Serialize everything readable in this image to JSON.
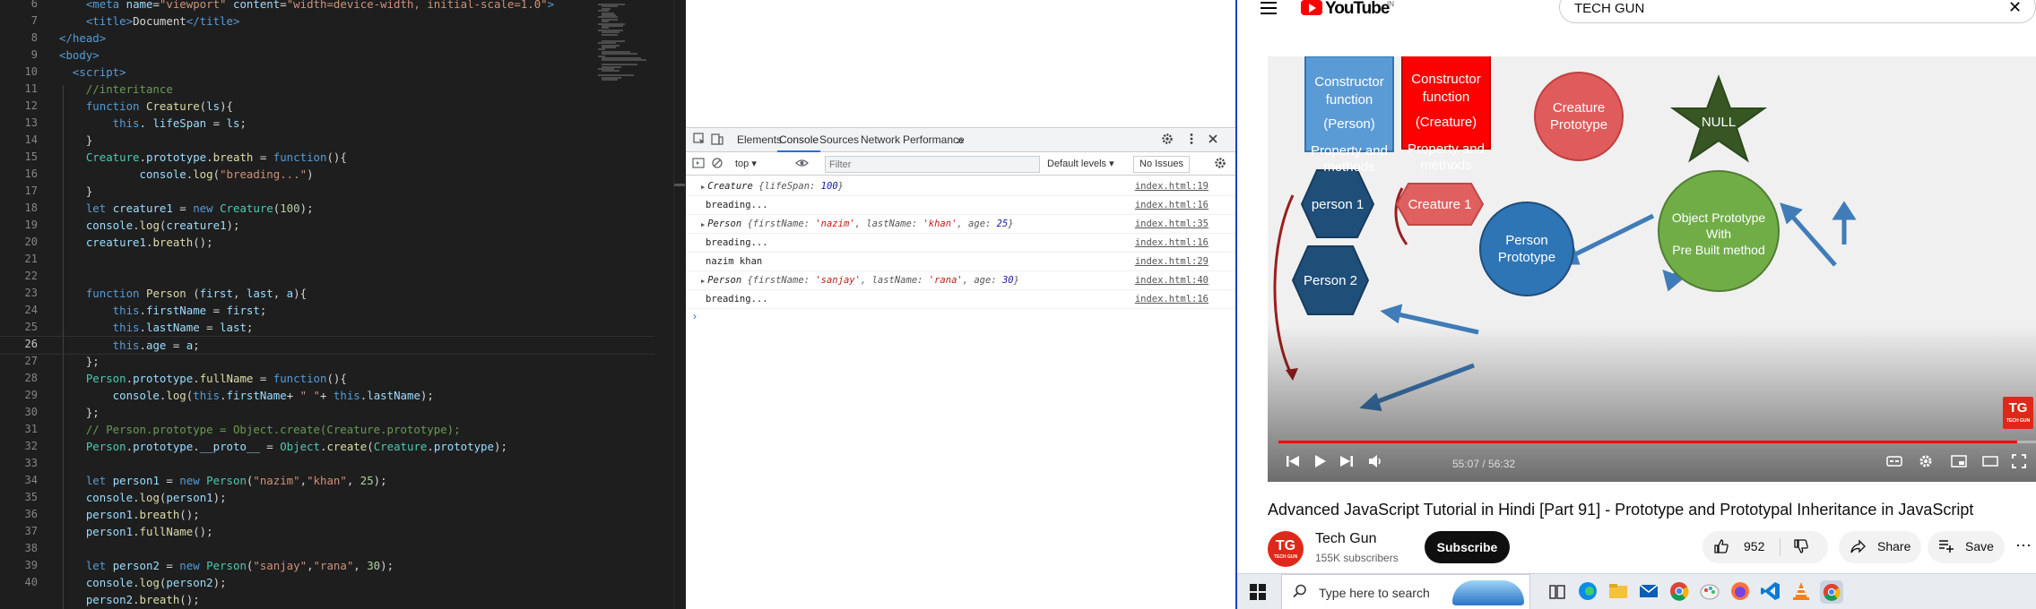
{
  "editor": {
    "line_numbers": [
      "6",
      "7",
      "8",
      "9",
      "10",
      "11",
      "12",
      "13",
      "14",
      "15",
      "16",
      "17",
      "18",
      "19",
      "20",
      "21",
      "22",
      "23",
      "24",
      "25",
      "26",
      "27",
      "28",
      "29",
      "30",
      "31",
      "32",
      "33",
      "34",
      "35",
      "36",
      "37",
      "38",
      "39",
      "40"
    ],
    "active_line": "26",
    "lines": [
      [
        [
          "tag",
          "    <meta "
        ],
        [
          "attr",
          "name"
        ],
        [
          "",
          "="
        ],
        [
          "str",
          "\"viewport\""
        ],
        [
          "",
          ""
        ],
        [
          "attr",
          " content"
        ],
        [
          "",
          "="
        ],
        [
          "str",
          "\"width=device-width, initial-scale=1.0\""
        ],
        [
          "tag",
          ">"
        ]
      ],
      [
        [
          "tag",
          "    <title>"
        ],
        [
          "",
          "Document"
        ],
        [
          "tag",
          "</title>"
        ]
      ],
      [
        [
          "tag",
          "</head>"
        ]
      ],
      [
        [
          "tag",
          "<body>"
        ]
      ],
      [
        [
          "tag",
          "  <script>"
        ]
      ],
      [
        [
          "cm",
          "    //interitance"
        ]
      ],
      [
        [
          "kw",
          "    function "
        ],
        [
          "fn",
          "Creature"
        ],
        [
          "",
          "("
        ],
        [
          "var",
          "ls"
        ],
        [
          "",
          "){"
        ]
      ],
      [
        [
          "kw",
          "        this"
        ],
        [
          "",
          ". "
        ],
        [
          "var",
          "lifeSpan"
        ],
        [
          "",
          " = "
        ],
        [
          "var",
          "ls"
        ],
        [
          "",
          ";"
        ]
      ],
      [
        [
          "",
          "    }"
        ]
      ],
      [
        [
          "cls",
          "    Creature"
        ],
        [
          "",
          "."
        ],
        [
          "var",
          "prototype"
        ],
        [
          "",
          "."
        ],
        [
          "fn",
          "breath"
        ],
        [
          "",
          " = "
        ],
        [
          "kw",
          "function"
        ],
        [
          "",
          "(){"
        ]
      ],
      [
        [
          "var",
          "            console"
        ],
        [
          "",
          "."
        ],
        [
          "fn",
          "log"
        ],
        [
          "",
          "("
        ],
        [
          "str",
          "\"breading...\""
        ],
        [
          "",
          ")"
        ]
      ],
      [
        [
          "",
          "    }"
        ]
      ],
      [
        [
          "kw",
          "    let "
        ],
        [
          "var",
          "creature1"
        ],
        [
          "",
          " = "
        ],
        [
          "kw",
          "new "
        ],
        [
          "cls",
          "Creature"
        ],
        [
          "",
          "("
        ],
        [
          "num",
          "100"
        ],
        [
          "",
          ");"
        ]
      ],
      [
        [
          "var",
          "    console"
        ],
        [
          "",
          "."
        ],
        [
          "fn",
          "log"
        ],
        [
          "",
          "("
        ],
        [
          "var",
          "creature1"
        ],
        [
          "",
          ");"
        ]
      ],
      [
        [
          "var",
          "    creature1"
        ],
        [
          "",
          "."
        ],
        [
          "fn",
          "breath"
        ],
        [
          "",
          "();"
        ]
      ],
      [
        [
          "",
          ""
        ]
      ],
      [
        [
          "",
          ""
        ]
      ],
      [
        [
          "kw",
          "    function "
        ],
        [
          "fn",
          "Person"
        ],
        [
          "",
          " ("
        ],
        [
          "var",
          "first"
        ],
        [
          "",
          ", "
        ],
        [
          "var",
          "last"
        ],
        [
          "",
          ", "
        ],
        [
          "var",
          "a"
        ],
        [
          "",
          "){"
        ]
      ],
      [
        [
          "kw",
          "        this"
        ],
        [
          "",
          "."
        ],
        [
          "var",
          "firstName"
        ],
        [
          "",
          " = "
        ],
        [
          "var",
          "first"
        ],
        [
          "",
          ";"
        ]
      ],
      [
        [
          "kw",
          "        this"
        ],
        [
          "",
          "."
        ],
        [
          "var",
          "lastName"
        ],
        [
          "",
          " = "
        ],
        [
          "var",
          "last"
        ],
        [
          "",
          ";"
        ]
      ],
      [
        [
          "kw",
          "        this"
        ],
        [
          "",
          "."
        ],
        [
          "var",
          "age"
        ],
        [
          "",
          " = "
        ],
        [
          "var",
          "a"
        ],
        [
          "",
          ";"
        ]
      ],
      [
        [
          "",
          "    };"
        ]
      ],
      [
        [
          "cls",
          "    Person"
        ],
        [
          "",
          "."
        ],
        [
          "var",
          "prototype"
        ],
        [
          "",
          "."
        ],
        [
          "fn",
          "fullName"
        ],
        [
          "",
          " = "
        ],
        [
          "kw",
          "function"
        ],
        [
          "",
          "(){"
        ]
      ],
      [
        [
          "var",
          "        console"
        ],
        [
          "",
          "."
        ],
        [
          "fn",
          "log"
        ],
        [
          "",
          "("
        ],
        [
          "kw",
          "this"
        ],
        [
          "",
          "."
        ],
        [
          "var",
          "firstName"
        ],
        [
          "",
          "+ "
        ],
        [
          "str",
          "\" \""
        ],
        [
          "",
          "+ "
        ],
        [
          "kw",
          "this"
        ],
        [
          "",
          "."
        ],
        [
          "var",
          "lastName"
        ],
        [
          "",
          ");"
        ]
      ],
      [
        [
          "",
          "    };"
        ]
      ],
      [
        [
          "cm",
          "    // Person.prototype = Object.create(Creature.prototype);"
        ]
      ],
      [
        [
          "cls",
          "    Person"
        ],
        [
          "",
          "."
        ],
        [
          "var",
          "prototype"
        ],
        [
          "",
          "."
        ],
        [
          "var",
          "__proto__"
        ],
        [
          "",
          " = "
        ],
        [
          "cls",
          "Object"
        ],
        [
          "",
          "."
        ],
        [
          "fn",
          "create"
        ],
        [
          "",
          "("
        ],
        [
          "cls",
          "Creature"
        ],
        [
          "",
          "."
        ],
        [
          "var",
          "prototype"
        ],
        [
          "",
          ");"
        ]
      ],
      [
        [
          "",
          ""
        ]
      ],
      [
        [
          "kw",
          "    let "
        ],
        [
          "var",
          "person1"
        ],
        [
          "",
          " = "
        ],
        [
          "kw",
          "new "
        ],
        [
          "cls",
          "Person"
        ],
        [
          "",
          "("
        ],
        [
          "str",
          "\"nazim\""
        ],
        [
          "",
          ","
        ],
        [
          "str",
          "\"khan\""
        ],
        [
          "",
          ", "
        ],
        [
          "num",
          "25"
        ],
        [
          "",
          ");"
        ]
      ],
      [
        [
          "var",
          "    console"
        ],
        [
          "",
          "."
        ],
        [
          "fn",
          "log"
        ],
        [
          "",
          "("
        ],
        [
          "var",
          "person1"
        ],
        [
          "",
          ");"
        ]
      ],
      [
        [
          "var",
          "    person1"
        ],
        [
          "",
          "."
        ],
        [
          "fn",
          "breath"
        ],
        [
          "",
          "();"
        ]
      ],
      [
        [
          "var",
          "    person1"
        ],
        [
          "",
          "."
        ],
        [
          "fn",
          "fullName"
        ],
        [
          "",
          "();"
        ]
      ],
      [
        [
          "",
          ""
        ]
      ],
      [
        [
          "kw",
          "    let "
        ],
        [
          "var",
          "person2"
        ],
        [
          "",
          " = "
        ],
        [
          "kw",
          "new "
        ],
        [
          "cls",
          "Person"
        ],
        [
          "",
          "("
        ],
        [
          "str",
          "\"sanjay\""
        ],
        [
          "",
          ","
        ],
        [
          "str",
          "\"rana\""
        ],
        [
          "",
          ", "
        ],
        [
          "num",
          "30"
        ],
        [
          "",
          ");"
        ]
      ],
      [
        [
          "var",
          "    console"
        ],
        [
          "",
          "."
        ],
        [
          "fn",
          "log"
        ],
        [
          "",
          "("
        ],
        [
          "var",
          "person2"
        ],
        [
          "",
          ");"
        ]
      ],
      [
        [
          "var",
          "    person2"
        ],
        [
          "",
          "."
        ],
        [
          "fn",
          "breath"
        ],
        [
          "",
          "();"
        ]
      ]
    ]
  },
  "devtools": {
    "tabs": [
      "Elements",
      "Console",
      "Sources",
      "Network",
      "Performance"
    ],
    "active_tab": "Console",
    "more_tabs": "»",
    "context": "top",
    "filter_placeholder": "Filter",
    "levels": "Default levels",
    "issues": "No Issues",
    "console": [
      {
        "expand": true,
        "parts": [
          [
            "t",
            "Creature "
          ],
          [
            "k",
            "{lifeSpan: "
          ],
          [
            "n",
            "100"
          ],
          [
            "k",
            "}"
          ]
        ],
        "src": "index.html:19"
      },
      {
        "expand": false,
        "parts": [
          [
            "",
            "breading..."
          ]
        ],
        "src": "index.html:16"
      },
      {
        "expand": true,
        "parts": [
          [
            "t",
            "Person "
          ],
          [
            "k",
            "{firstName: "
          ],
          [
            "s",
            "'nazim'"
          ],
          [
            "k",
            ", lastName: "
          ],
          [
            "s",
            "'khan'"
          ],
          [
            "k",
            ", age: "
          ],
          [
            "n",
            "25"
          ],
          [
            "k",
            "}"
          ]
        ],
        "src": "index.html:35"
      },
      {
        "expand": false,
        "parts": [
          [
            "",
            "breading..."
          ]
        ],
        "src": "index.html:16"
      },
      {
        "expand": false,
        "parts": [
          [
            "",
            "nazim khan"
          ]
        ],
        "src": "index.html:29"
      },
      {
        "expand": true,
        "parts": [
          [
            "t",
            "Person "
          ],
          [
            "k",
            "{firstName: "
          ],
          [
            "s",
            "'sanjay'"
          ],
          [
            "k",
            ", lastName: "
          ],
          [
            "s",
            "'rana'"
          ],
          [
            "k",
            ", age: "
          ],
          [
            "n",
            "30"
          ],
          [
            "k",
            "}"
          ]
        ],
        "src": "index.html:40"
      },
      {
        "expand": false,
        "parts": [
          [
            "",
            "breading..."
          ]
        ],
        "src": "index.html:16"
      }
    ],
    "prompt": "›"
  },
  "youtube": {
    "logo_text": "YouTube",
    "region": "IN",
    "search_value": "TECH GUN",
    "close": "✕",
    "slide": {
      "box1": [
        "Constructor",
        "function",
        "(Person)",
        "Property and",
        "methods"
      ],
      "box2": [
        "Constructor",
        "function",
        "(Creature)",
        "Property and",
        "methods"
      ],
      "creature_proto": [
        "Creature",
        "Prototype"
      ],
      "null_label": "NULL",
      "creature1": "Creature 1",
      "person1": "person 1",
      "person2": "Person 2",
      "person_proto": [
        "Person",
        "Prototype"
      ],
      "object_proto": [
        "Object Prototype",
        "With",
        "Pre Built method"
      ]
    },
    "player": {
      "time": "55:07 / 56:32",
      "progress": 0.975,
      "badge": "TG",
      "badge_sub": "TECH GUN"
    },
    "title": "Advanced JavaScript Tutorial in Hindi [Part 91] - Prototype and Prototypal Inheritance in JavaScript",
    "channel": {
      "avatar": "TG",
      "avatar_sub": "TECH GUN",
      "name": "Tech Gun",
      "subs": "155K subscribers",
      "subscribe": "Subscribe"
    },
    "actions": {
      "likes": "952",
      "share": "Share",
      "save": "Save",
      "more": "⋯"
    },
    "colors": {
      "red": "#ff0000",
      "blue_box": "#5b9bd5",
      "red_box": "#ff0000",
      "hexagon": "#1f4e79",
      "green": "#70ad47",
      "star": "#375623",
      "salmon": "#e06060"
    }
  },
  "taskbar": {
    "search_placeholder": "Type here to search",
    "apps": [
      "task-view",
      "edge",
      "file-explorer",
      "mail",
      "chrome",
      "paint",
      "firefox",
      "vscode",
      "vlc",
      "chrome-active"
    ]
  }
}
